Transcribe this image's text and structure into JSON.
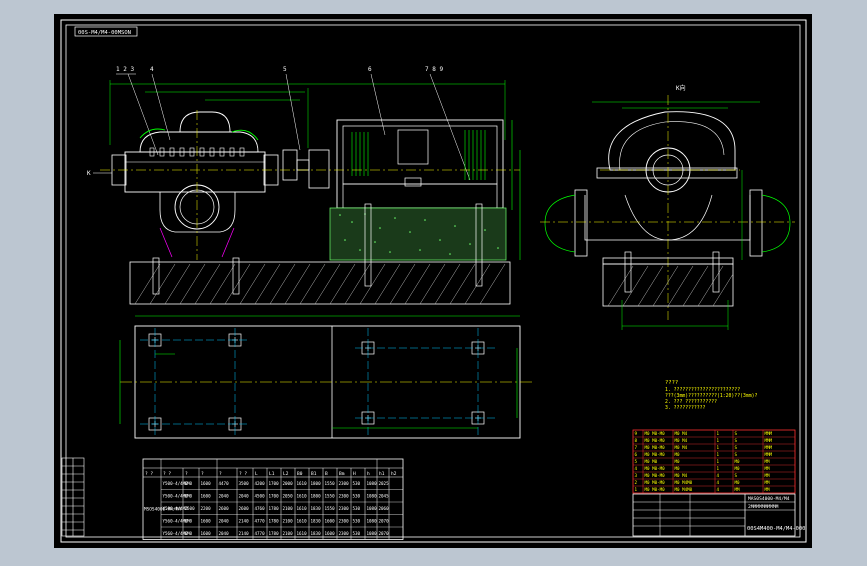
{
  "drawing": {
    "code_box": "00S-M4/M4-00MSON",
    "title_block": {
      "line1": "MAS0S4000-M4/M4",
      "line2": "2MMMMMMMMMM",
      "drawing_no": "00S4M400-M4/M4-000"
    }
  },
  "colors": {
    "frame": "#ffffff",
    "outline": "#ffffff",
    "dimension": "#00ff00",
    "centerline": "#ffff00",
    "hatch": "#b8b8b8",
    "bom": "#ff3030",
    "foundation": "#6cff6c",
    "magenta": "#ff00ff"
  },
  "side_view": {
    "labels": [
      "1 2 3",
      "4",
      "5",
      "6",
      "7 8 9"
    ],
    "left_marker": "K"
  },
  "end_view": {
    "label": "K向"
  },
  "notes": {
    "title": "????",
    "lines": [
      "1. ???????????????????????",
      "   ???(3mm)??????????(1:20)??(3mm)?",
      "2. ???   ???????????",
      "3. ???????????"
    ]
  },
  "table": {
    "headers": [
      "? ?",
      "? ?",
      "?",
      "?",
      "?",
      "? ?",
      "L",
      "L1",
      "L2",
      "B0",
      "B1",
      "B",
      "Bm",
      "H",
      "h",
      "h1",
      "h2",
      "hL"
    ],
    "model": "MSOS4000-M4/M4",
    "rows": [
      [
        "Y500-4/4M0",
        "6M0",
        "1600",
        "4470",
        "3500",
        "4200",
        "1700",
        "2000",
        "1610",
        "1800",
        "1550",
        "2300",
        "530",
        "1080",
        "2025"
      ],
      [
        "Y500-4/4M0",
        "6M0",
        "1600",
        "2040",
        "2040",
        "4500",
        "1700",
        "2050",
        "1610",
        "1800",
        "1550",
        "2300",
        "530",
        "1080",
        "2045"
      ],
      [
        "Y500-4/4M0",
        "2500",
        "2200",
        "2600",
        "2600",
        "4760",
        "1780",
        "2100",
        "1610",
        "1830",
        "1550",
        "2300",
        "530",
        "1080",
        "2060"
      ],
      [
        "Y560-4/4M0",
        "6M0",
        "1600",
        "2040",
        "2140",
        "4770",
        "1780",
        "2100",
        "1610",
        "1830",
        "1600",
        "2300",
        "530",
        "1080",
        "2070"
      ],
      [
        "Y560-4/4M0",
        "6M0",
        "1600",
        "2040",
        "2140",
        "4770",
        "1780",
        "2100",
        "1610",
        "1830",
        "1600",
        "2300",
        "530",
        "1080",
        "2070"
      ]
    ]
  },
  "bom": {
    "rows": [
      [
        "9",
        "M0 M0-M0",
        "M0 M4",
        "1",
        "S",
        "MMM"
      ],
      [
        "8",
        "M0 M0-M0",
        "M0 M4",
        "1",
        "S",
        "MMM"
      ],
      [
        "7",
        "M0 M0-M0",
        "M0 M4",
        "1",
        "S",
        "MMM"
      ],
      [
        "6",
        "M0 M0-M0",
        "M0",
        "1",
        "S",
        "MMM"
      ],
      [
        "5",
        "M0 M0",
        "M0",
        "1",
        "M0",
        "MM"
      ],
      [
        "4",
        "M0 M0-M0",
        "M0",
        "1",
        "M0",
        "MM"
      ],
      [
        "3",
        "M0 M0-M0",
        "M0 M4",
        "4",
        "S",
        "MM"
      ],
      [
        "2",
        "M0 M0-M0",
        "M0 M4M0",
        "4",
        "M0",
        "MM"
      ],
      [
        "1",
        "M0 M0-M0",
        "M0 M4M0",
        "4",
        "MM",
        "MM"
      ]
    ]
  }
}
